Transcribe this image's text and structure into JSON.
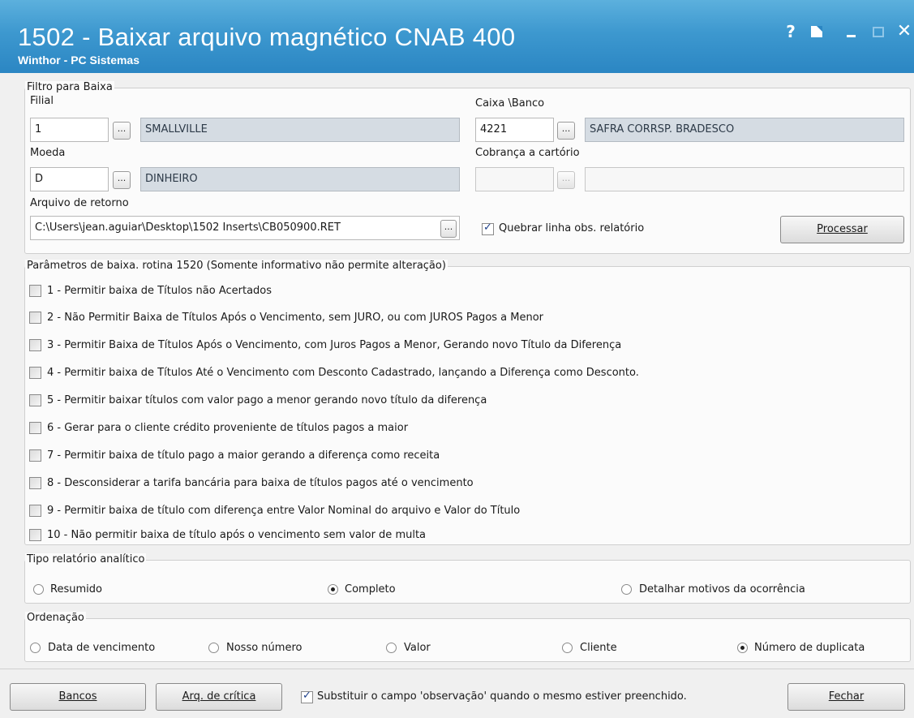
{
  "window": {
    "title": "1502 - Baixar arquivo magnético CNAB 400",
    "subtitle": "Winthor - PC Sistemas",
    "controls": {
      "help": "?",
      "close": "✕"
    }
  },
  "filtro": {
    "legend": "Filtro para Baixa",
    "filial_label": "Filial",
    "filial_code": "1",
    "filial_name": "SMALLVILLE",
    "caixa_label": "Caixa \\Banco",
    "caixa_code": "4221",
    "caixa_name": "SAFRA CORRSP. BRADESCO",
    "moeda_label": "Moeda",
    "moeda_code": "D",
    "moeda_name": "DINHEIRO",
    "cobranca_label": "Cobrança a cartório",
    "cobranca_code": "",
    "cobranca_name": "",
    "arquivo_label": "Arquivo de retorno",
    "arquivo_value": "C:\\Users\\jean.aguiar\\Desktop\\1502 Inserts\\CB050900.RET",
    "browse_label": "...",
    "quebrar_label": "Quebrar linha obs. relatório",
    "quebrar_checked": true,
    "processar_label": "Processar"
  },
  "parametros": {
    "legend": "Parâmetros de baixa. rotina 1520 (Somente informativo não permite alteração)",
    "items": [
      {
        "label": "1 - Permitir baixa de Títulos não Acertados",
        "checked": false
      },
      {
        "label": "2 - Não Permitir Baixa de Títulos Após o Vencimento, sem JURO, ou com JUROS Pagos a Menor",
        "checked": false
      },
      {
        "label": "3 - Permitir Baixa de Títulos Após o Vencimento, com Juros Pagos a Menor, Gerando novo Título da Diferença",
        "checked": false
      },
      {
        "label": "4 - Permitir baixa de Títulos Até o Vencimento com Desconto Cadastrado, lançando a Diferença como Desconto.",
        "checked": false
      },
      {
        "label": "5 - Permitir baixar títulos com valor pago a menor gerando novo título da diferença",
        "checked": false
      },
      {
        "label": "6 - Gerar para o cliente crédito proveniente de títulos pagos a maior",
        "checked": false
      },
      {
        "label": "7 - Permitir baixa de título pago a maior gerando a diferença como receita",
        "checked": false
      },
      {
        "label": "8 - Desconsiderar a tarifa bancária para baixa de títulos pagos até o vencimento",
        "checked": false
      },
      {
        "label": "9 - Permitir baixa de título com diferença entre Valor Nominal do arquivo e Valor do Título",
        "checked": false
      },
      {
        "label": "10 - Não permitir baixa de título após o vencimento sem valor de multa",
        "checked": false
      }
    ]
  },
  "tipo_relatorio": {
    "legend": "Tipo relatório analítico",
    "options": [
      "Resumido",
      "Completo",
      "Detalhar motivos da ocorrência"
    ],
    "selected": "Completo"
  },
  "ordenacao": {
    "legend": "Ordenação",
    "options": [
      "Data de vencimento",
      "Nosso número",
      "Valor",
      "Cliente",
      "Número de duplicata"
    ],
    "selected": "Número de duplicata"
  },
  "footer": {
    "bancos_label": "Bancos",
    "critica_label": "Arq. de crítica",
    "substituir_label": "Substituir o campo 'observação' quando o mesmo estiver preenchido.",
    "substituir_checked": true,
    "fechar_label": "Fechar"
  }
}
